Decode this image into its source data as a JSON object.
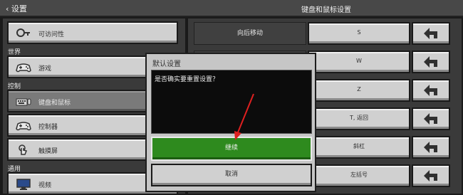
{
  "header": {
    "back_label": "设置",
    "title": "键盘和鼠标设置"
  },
  "sidebar": {
    "items": [
      {
        "label": "可访问性",
        "icon": "key-icon"
      },
      {
        "label": "游戏",
        "icon": "gamepad-icon"
      },
      {
        "label": "键盘和鼠标",
        "icon": "keyboard-icon"
      },
      {
        "label": "控制器",
        "icon": "controller-icon"
      },
      {
        "label": "触摸屏",
        "icon": "touch-icon"
      },
      {
        "label": "视频",
        "icon": "monitor-icon"
      }
    ],
    "sections": [
      "世界",
      "控制",
      "通用"
    ],
    "selected_index": 2
  },
  "keybindings": [
    {
      "action": "向后移动",
      "key": "S"
    },
    {
      "action": "",
      "key": "W"
    },
    {
      "action": "",
      "key": "Z"
    },
    {
      "action": "",
      "key": "T, 返回"
    },
    {
      "action": "",
      "key": "斜杠"
    },
    {
      "action": "",
      "key": "左括号"
    }
  ],
  "dialog": {
    "title": "默认设置",
    "message": "是否确实要重置设置？",
    "continue_label": "继续",
    "cancel_label": "取消"
  },
  "colors": {
    "accent_green": "#2e8a1e",
    "annotation_red": "#e02020"
  }
}
